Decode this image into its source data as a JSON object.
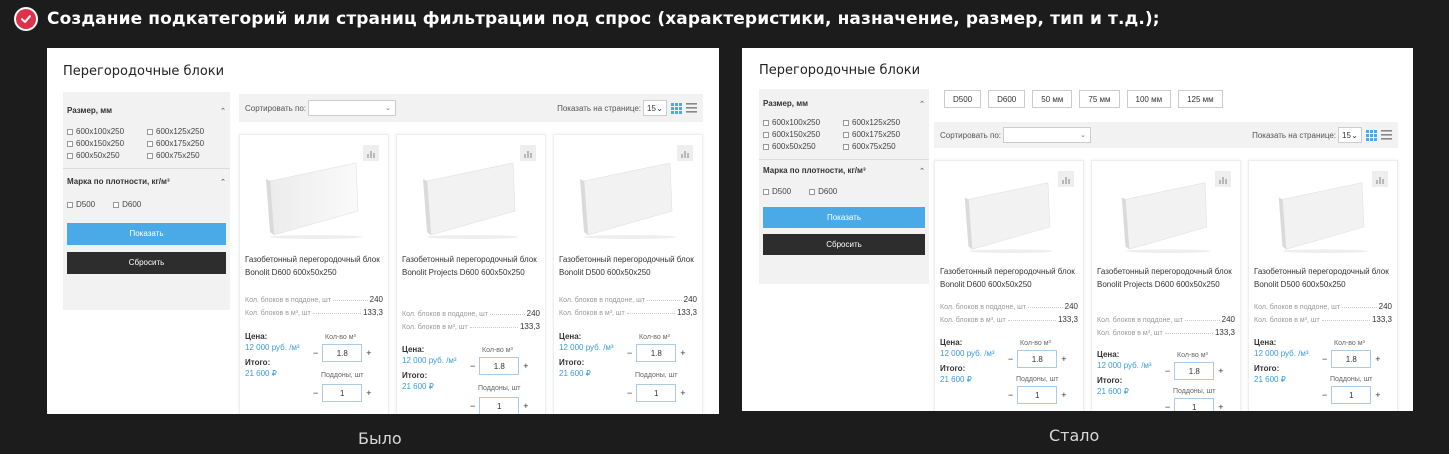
{
  "headline": "Создание подкатегорий или страниц фильтрации под спрос (характеристики, назначение, размер, тип и т.д.);",
  "captions": {
    "before": "Было",
    "after": "Стало"
  },
  "colors": {
    "accent_blue": "#4aaae8",
    "check_red": "#e0314a",
    "dark_button": "#2d2d2d"
  },
  "page_title": "Перегородочные блоки",
  "sidebar": {
    "size_heading": "Размер, мм",
    "sizes": [
      "600x100x250",
      "600x125x250",
      "600x150x250",
      "600x175x250",
      "600x50x250",
      "600x75x250"
    ],
    "density_heading": "Марка по плотности, кг/м³",
    "densities": [
      "D500",
      "D600"
    ],
    "show_button": "Показать",
    "reset_button": "Сбросить"
  },
  "toolbar": {
    "sort_label": "Сортировать по:",
    "per_page_label": "Показать на странице:",
    "per_page_value": "15"
  },
  "filter_buttons": [
    "D500",
    "D600",
    "50 мм",
    "75 мм",
    "100 мм",
    "125 мм"
  ],
  "labels": {
    "spec_count": "Кол. блоков в поддоне, шт",
    "spec_volume": "Кол. блоков в м³, шт",
    "price": "Цена:",
    "total": "Итого:",
    "qty_m3": "Кол-во м³",
    "pallets": "Поддоны, шт",
    "unit": "/м³"
  },
  "products": [
    {
      "name": "Газобетонный перегородочный блок Bonolit D600 600x50x250",
      "count": "240",
      "per_m3": "133,3",
      "price": "12 000 руб.",
      "total": "21 600 ₽",
      "qty": "1.8",
      "pallets": "1"
    },
    {
      "name": "Газобетонный перегородочный блок Bonolit Projects D600 600x50x250",
      "count": "240",
      "per_m3": "133,3",
      "price": "12 000 руб.",
      "total": "21 600 ₽",
      "qty": "1.8",
      "pallets": "1"
    },
    {
      "name": "Газобетонный перегородочный блок Bonolit D500 600x50x250",
      "count": "240",
      "per_m3": "133,3",
      "price": "12 000 руб.",
      "total": "21 600 ₽",
      "qty": "1.8",
      "pallets": "1"
    }
  ]
}
